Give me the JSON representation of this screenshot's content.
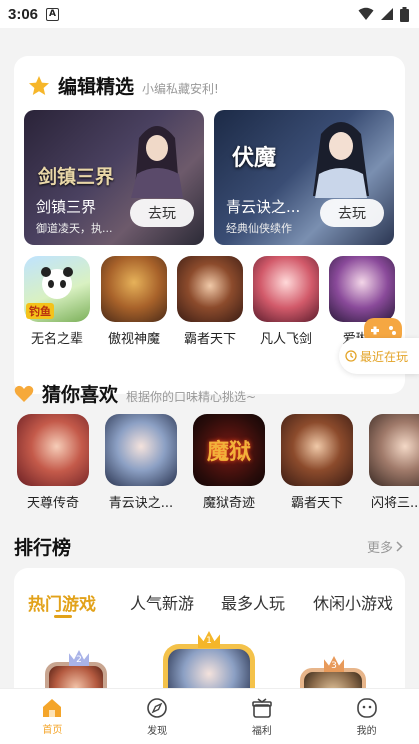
{
  "status_bar": {
    "time": "3:06",
    "app_badge": "A"
  },
  "editors_pick": {
    "title": "编辑精选",
    "subtitle": "小编私藏安利!",
    "features": [
      {
        "name": "剑镇三界",
        "desc": "御道凌天，执...",
        "play": "去玩",
        "logo": "剑镇三界"
      },
      {
        "name": "青云诀之...",
        "desc": "经典仙侠续作",
        "play": "去玩",
        "logo": "伏魔"
      }
    ],
    "games": [
      {
        "name": "无名之辈",
        "badge": "钓鱼"
      },
      {
        "name": "傲视神魔"
      },
      {
        "name": "霸者天下"
      },
      {
        "name": "凡人飞剑"
      },
      {
        "name": "爱琳..."
      }
    ],
    "recent_label": "最近在玩"
  },
  "guess": {
    "title": "猜你喜欢",
    "subtitle": "根据你的口味精心挑选~",
    "games": [
      {
        "name": "天尊传奇"
      },
      {
        "name": "青云诀之..."
      },
      {
        "name": "魔狱奇迹",
        "logo": "魔狱"
      },
      {
        "name": "霸者天下"
      },
      {
        "name": "闪将三..."
      }
    ]
  },
  "ranking": {
    "title": "排行榜",
    "more": "更多",
    "tabs": [
      "热门游戏",
      "人气新游",
      "最多人玩",
      "休闲小游戏"
    ],
    "active_tab": 0,
    "podium": [
      "1",
      "2",
      "3"
    ]
  },
  "bottom_nav": [
    {
      "label": "首页",
      "active": true
    },
    {
      "label": "发现"
    },
    {
      "label": "福利"
    },
    {
      "label": "我的"
    }
  ],
  "colors": {
    "accent": "#f4a52a",
    "tab_active": "#e2a21a",
    "background": "#f3f3f3"
  }
}
